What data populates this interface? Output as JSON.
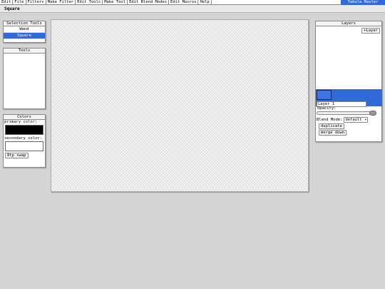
{
  "menubar": {
    "items": [
      "Edit",
      "File",
      "Filters",
      "Make Filter",
      "Edit Tools",
      "Make Tool",
      "Edit Blend Modes",
      "Edit Macros",
      "Help"
    ],
    "brand": "Tabula Master"
  },
  "toolbar": {
    "current_tool": "Square"
  },
  "selection_tools": {
    "title": "Selection Tools",
    "items": [
      {
        "label": "Wand",
        "active": false
      },
      {
        "label": "Square",
        "active": true
      }
    ]
  },
  "tools": {
    "title": "Tools"
  },
  "colors": {
    "title": "Colors",
    "primary_label": "primary color:",
    "primary_value": "#000000",
    "secondary_label": "secondary color:",
    "secondary_value": "#ffffff",
    "swap_label": "8tp swap"
  },
  "layers": {
    "title": "Layers",
    "add_label": "+Layer",
    "selected_color": "#2f6ad8",
    "layer_name": "Layer 1",
    "opacity_label": "Opacity:",
    "opacity_value": 1.0,
    "blend_mode_label": "Blend Mode:",
    "blend_mode_value": "default",
    "duplicate_label": "duplicate",
    "merge_down_label": "merge down"
  }
}
